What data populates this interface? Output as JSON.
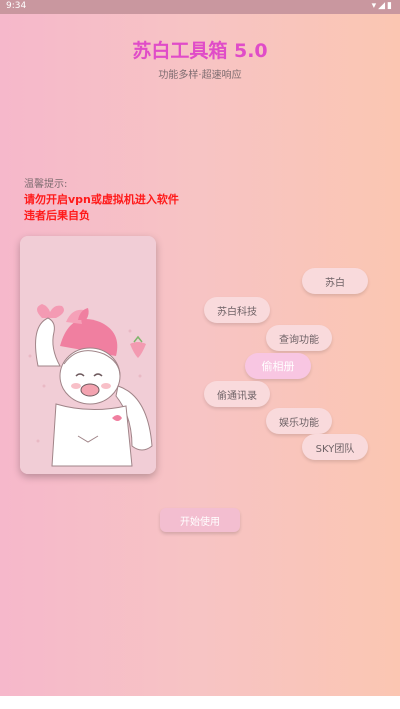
{
  "status_bar": {
    "time": "9:34",
    "icons": "▾◢▮"
  },
  "header": {
    "title": "苏白工具箱 5.0",
    "subtitle": "功能多样·超速响应"
  },
  "notice": {
    "label": "温馨提示:",
    "line1": "请勿开启vpn或虚拟机进入软件",
    "line2": "违者后果自负"
  },
  "menu": {
    "items": [
      {
        "label": "苏白"
      },
      {
        "label": "苏白科技"
      },
      {
        "label": "查询功能"
      },
      {
        "label": "偷相册"
      },
      {
        "label": "偷通讯录"
      },
      {
        "label": "娱乐功能"
      },
      {
        "label": "SKY团队"
      }
    ]
  },
  "start_button": {
    "label": "开始使用"
  },
  "colors": {
    "title": "#e04cc8",
    "warning": "#ff1a1a",
    "pill_bg": "#f9dadc",
    "active_pill_bg": "#f8c6e2"
  }
}
